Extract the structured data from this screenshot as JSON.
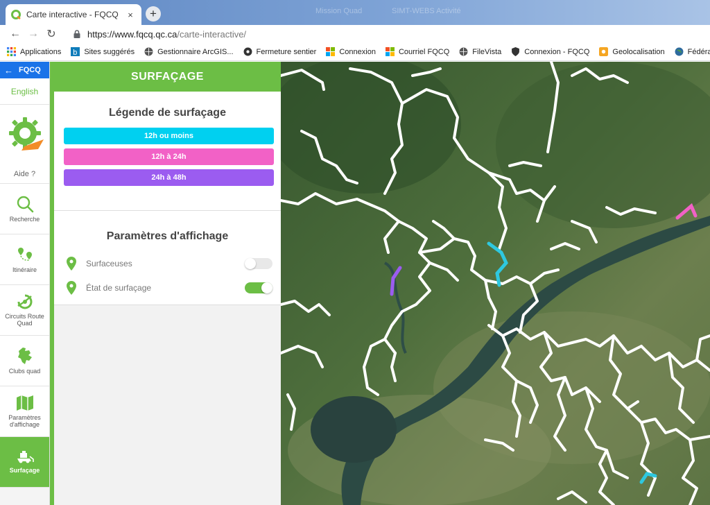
{
  "browser": {
    "tab_title": "Carte interactive - FQCQ",
    "close_glyph": "×",
    "newtab_glyph": "+",
    "ghost_tabs": [
      "Mission Quad",
      "SIMT-WEBS Activité"
    ],
    "back_glyph": "←",
    "forward_glyph": "→",
    "reload_glyph": "↻",
    "url_host": "https://www.fqcq.qc.ca",
    "url_path": "/carte-interactive/"
  },
  "bookmarks": [
    {
      "label": "Applications",
      "icon": "apps-grid-icon"
    },
    {
      "label": "Sites suggérés",
      "icon": "bing-icon"
    },
    {
      "label": "Gestionnaire ArcGIS...",
      "icon": "globe-icon"
    },
    {
      "label": "Fermeture sentier",
      "icon": "circle-icon"
    },
    {
      "label": "Connexion",
      "icon": "microsoft-icon"
    },
    {
      "label": "Courriel FQCQ",
      "icon": "microsoft-icon"
    },
    {
      "label": "FileVista",
      "icon": "globe-icon"
    },
    {
      "label": "Connexion - FQCQ",
      "icon": "shield-icon"
    },
    {
      "label": "Geolocalisation",
      "icon": "location-icon"
    },
    {
      "label": "Fédération Québéc...",
      "icon": "earth-icon"
    }
  ],
  "sidebar": {
    "back_label": "FQCQ",
    "lang_label": "English",
    "help_label": "Aide ?",
    "items": [
      {
        "label": "Recherche"
      },
      {
        "label": "Itinéraire"
      },
      {
        "label": "Circuits Route Quad"
      },
      {
        "label": "Clubs quad"
      },
      {
        "label": "Paramètres d'affichage"
      },
      {
        "label": "Surfaçage"
      }
    ]
  },
  "panel": {
    "title": "SURFAÇAGE",
    "legend_title": "Légende de surfaçage",
    "legend": [
      {
        "label": "12h ou moins",
        "color": "#00d0f0"
      },
      {
        "label": "12h à 24h",
        "color": "#f261c6"
      },
      {
        "label": "24h à 48h",
        "color": "#9b5cf0"
      }
    ],
    "params_title": "Paramètres d'affichage",
    "params": [
      {
        "label": "Surfaceuses",
        "enabled": false
      },
      {
        "label": "État de surfaçage",
        "enabled": true
      }
    ]
  },
  "colors": {
    "accent_green": "#6cbe45",
    "brand_blue": "#1a73e8",
    "trail_white": "#ffffff"
  }
}
